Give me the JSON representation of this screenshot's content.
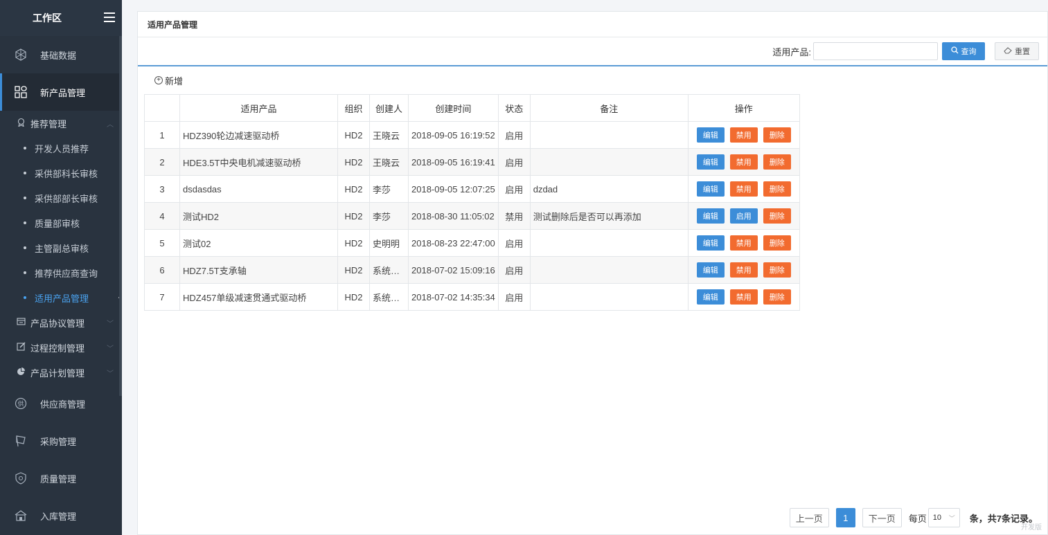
{
  "sidebar": {
    "title": "工作区",
    "top_items": [
      {
        "label": "基础数据",
        "icon": "cube-icon"
      },
      {
        "label": "新产品管理",
        "icon": "grid-icon"
      }
    ],
    "group": {
      "label": "推荐管理",
      "icon": "badge-icon"
    },
    "sub_items": [
      "开发人员推荐",
      "采供部科长审核",
      "采供部部长审核",
      "质量部审核",
      "主管副总审核",
      "推荐供应商查询",
      "适用产品管理"
    ],
    "groups_after": [
      {
        "label": "产品协议管理",
        "icon": "card-icon"
      },
      {
        "label": "过程控制管理",
        "icon": "edit-icon"
      },
      {
        "label": "产品计划管理",
        "icon": "pie-icon"
      }
    ],
    "bottom_items": [
      {
        "label": "供应商管理",
        "icon": "supplier-icon"
      },
      {
        "label": "采购管理",
        "icon": "flag-icon"
      },
      {
        "label": "质量管理",
        "icon": "shield-icon"
      },
      {
        "label": "入库管理",
        "icon": "warehouse-icon"
      }
    ]
  },
  "panel": {
    "title": "适用产品管理",
    "search_label": "适用产品:",
    "search_value": "",
    "query_label": "查询",
    "reset_label": "重置",
    "add_label": "新增"
  },
  "table": {
    "headers": [
      "",
      "适用产品",
      "组织",
      "创建人",
      "创建时间",
      "状态",
      "备注",
      "操作"
    ],
    "rows": [
      {
        "no": "1",
        "product": "HDZ390轮边减速驱动桥",
        "org": "HD2",
        "creator": "王晓云",
        "time": "2018-09-05 16:19:52",
        "status": "启用",
        "remark": "",
        "toggle": "禁用"
      },
      {
        "no": "2",
        "product": "HDE3.5T中央电机减速驱动桥",
        "org": "HD2",
        "creator": "王晓云",
        "time": "2018-09-05 16:19:41",
        "status": "启用",
        "remark": "",
        "toggle": "禁用"
      },
      {
        "no": "3",
        "product": "dsdasdas",
        "org": "HD2",
        "creator": "李莎",
        "time": "2018-09-05 12:07:25",
        "status": "启用",
        "remark": "dzdad",
        "toggle": "禁用"
      },
      {
        "no": "4",
        "product": "测试HD2",
        "org": "HD2",
        "creator": "李莎",
        "time": "2018-08-30 11:05:02",
        "status": "禁用",
        "remark": "测试删除后是否可以再添加",
        "toggle": "启用"
      },
      {
        "no": "5",
        "product": "测试02",
        "org": "HD2",
        "creator": "史明明",
        "time": "2018-08-23 22:47:00",
        "status": "启用",
        "remark": "",
        "toggle": "禁用"
      },
      {
        "no": "6",
        "product": "HDZ7.5T支承轴",
        "org": "HD2",
        "creator": "系统…",
        "time": "2018-07-02 15:09:16",
        "status": "启用",
        "remark": "",
        "toggle": "禁用"
      },
      {
        "no": "7",
        "product": "HDZ457单级减速贯通式驱动桥",
        "org": "HD2",
        "creator": "系统…",
        "time": "2018-07-02 14:35:34",
        "status": "启用",
        "remark": "",
        "toggle": "禁用"
      }
    ],
    "edit_label": "编辑",
    "delete_label": "删除",
    "colors": {
      "edit": "#3c8dd8",
      "disable": "#f26b2f",
      "enable": "#3c8dd8",
      "delete": "#f26b2f"
    }
  },
  "pager": {
    "prev": "上一页",
    "current": "1",
    "next": "下一页",
    "per_page_label": "每页",
    "per_page_value": "10",
    "total_text": "条，共7条记录。",
    "watermark": "开发版"
  }
}
